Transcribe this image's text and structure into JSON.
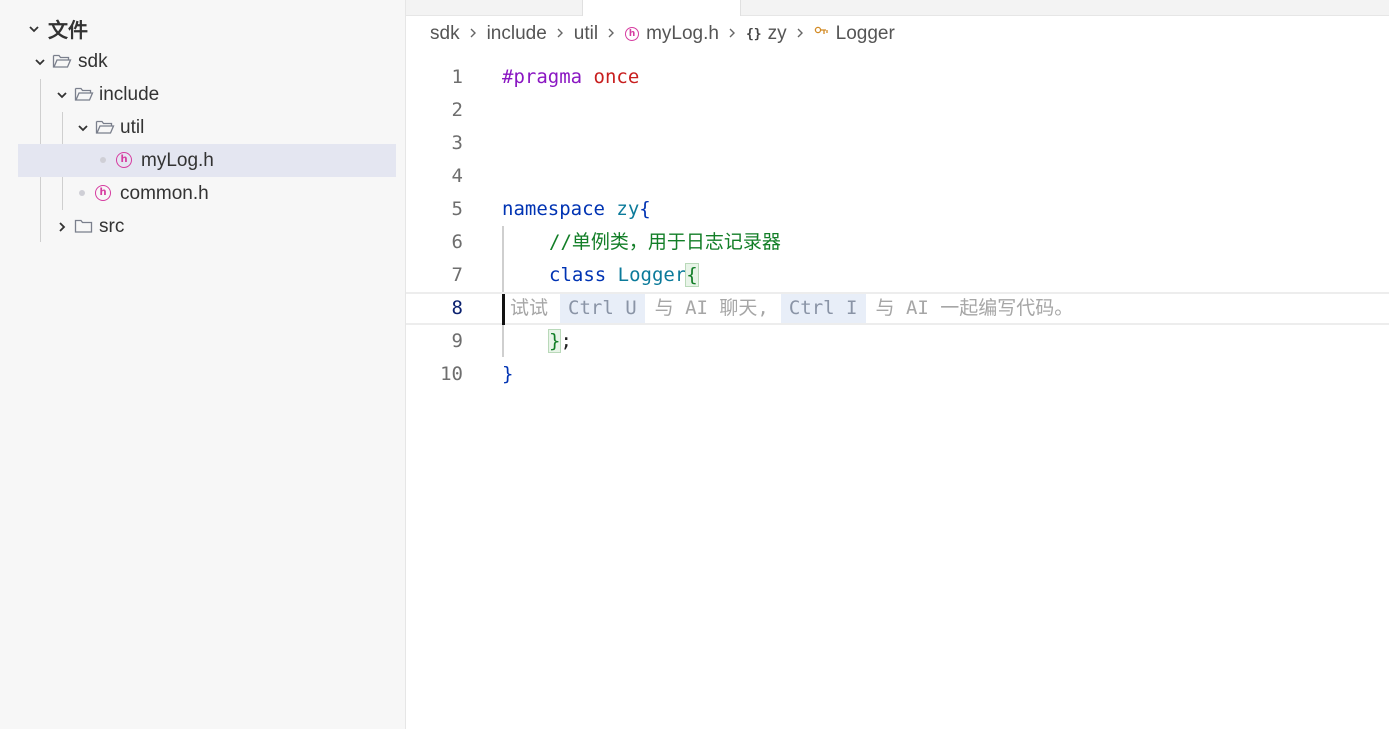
{
  "sidebar": {
    "root_label": "文件",
    "items": [
      {
        "label": "sdk"
      },
      {
        "label": "include"
      },
      {
        "label": "util"
      },
      {
        "label": "myLog.h"
      },
      {
        "label": "common.h"
      },
      {
        "label": "src"
      }
    ]
  },
  "breadcrumb": {
    "items": [
      "sdk",
      "include",
      "util",
      "myLog.h",
      "zy",
      "Logger"
    ]
  },
  "editor": {
    "lines": [
      {
        "n": "1",
        "tokens": [
          "#pragma",
          "once"
        ]
      },
      {
        "n": "2"
      },
      {
        "n": "3"
      },
      {
        "n": "4"
      },
      {
        "n": "5",
        "tokens": [
          "namespace",
          "zy",
          "{"
        ]
      },
      {
        "n": "6",
        "tokens": [
          "//单例类，用于日志记录器"
        ]
      },
      {
        "n": "7",
        "tokens": [
          "class",
          "Logger",
          "{"
        ]
      },
      {
        "n": "8"
      },
      {
        "n": "9",
        "tokens": [
          "}",
          ";"
        ]
      },
      {
        "n": "10",
        "tokens": [
          "}"
        ]
      }
    ],
    "ai_hint": {
      "try": "试试",
      "key1": "Ctrl U",
      "mid": "与 AI 聊天,",
      "key2": "Ctrl I",
      "end": "与 AI 一起编写代码。"
    }
  },
  "colors": {
    "selected_row": "#e4e6f1",
    "header_icon": "#d63ca0",
    "keyword": "#0033b3",
    "comment": "#127e27"
  }
}
